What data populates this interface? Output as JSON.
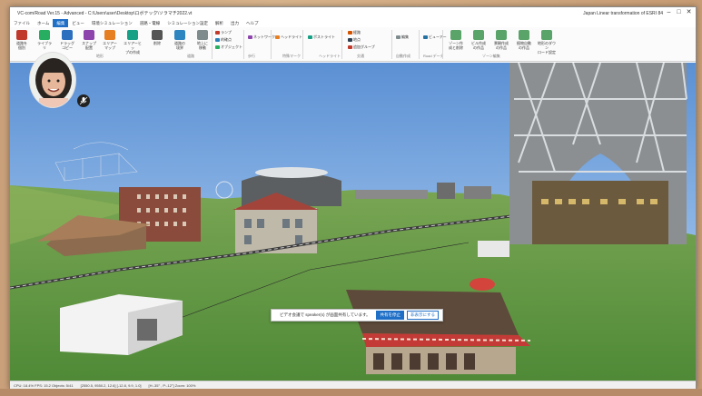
{
  "window": {
    "title": "VC-com/Road Ver.15 - Advanced - C:\\Users\\user\\Desktop\\ロボテック\\ソラマチ2022.vt",
    "right_text": "Japan   Linear transformation of ESRI 84"
  },
  "menu": [
    "ファイル",
    "ホーム",
    "編集",
    "ビュー",
    "環境シミュレーション",
    "道路・電線",
    "シミュレーション設定",
    "解析",
    "出力",
    "ヘルプ"
  ],
  "active_menu": "編集",
  "ribbon": {
    "buttons": [
      {
        "label": "道路を\n個別",
        "color": "#c0392b"
      },
      {
        "label": "ライブラ\nリ",
        "color": "#27ae60"
      },
      {
        "label": "ドラッグ\nコピー",
        "color": "#2c6fbf"
      },
      {
        "label": "スナップ\n配置",
        "color": "#8e44ad"
      },
      {
        "label": "エリアー\nマップ",
        "color": "#e67e22"
      },
      {
        "label": "エリアーヒッ\nプの作成",
        "color": "#16a085"
      },
      {
        "label": "削除",
        "color": "#555555"
      },
      {
        "label": "道路の\n境界",
        "color": "#2e86c1"
      },
      {
        "label": "地上に\n移動",
        "color": "#7f8c8d"
      }
    ],
    "group_labels": [
      "地形",
      "道路",
      "歩行",
      "特殊マーク",
      "ヘッドライト",
      "交通",
      "自動作成",
      "Road データ",
      "ゾーン編集"
    ],
    "small_items": [
      "ランプ",
      "的確点",
      "オブジェクト",
      "ネットワーク",
      "ヘッドライト",
      "ポストライト",
      "経路",
      "地点",
      "追加グループ",
      "編集",
      "ビューアー"
    ],
    "zone_buttons": [
      "ゾーン作\n成と削除",
      "ビル作成\nの作品",
      "景観作成\nの作品",
      "植物自動\nの作品",
      "地形のダウン\nロード設定"
    ]
  },
  "toast": {
    "message": "ビデオ会議で speaker(s) が画面共有しています。",
    "primary": "共有を停止",
    "secondary": "非表示にする"
  },
  "status": {
    "left": "CPU: 18.4%  FPS: 15.2  Objects: 5/41",
    "mid": "[2550.5, 9550.2, 12.6]  [-12.8, 9.9, 1.0]",
    "right": "[H:-35° , P:-12°]  Zoom: 100%"
  }
}
